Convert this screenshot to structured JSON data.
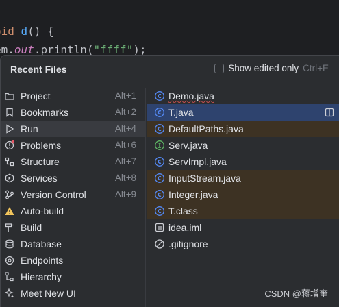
{
  "editor": {
    "line1": {
      "keyword": "oid",
      "method": "d",
      "rest": "() {"
    },
    "line2": {
      "prefix": "em.",
      "field": "out",
      "call": ".println(",
      "string": "\"ffff\"",
      "suffix": ");"
    }
  },
  "popup": {
    "title": "Recent Files",
    "show_edited_label": "Show edited only",
    "show_edited_shortcut": "Ctrl+E",
    "show_edited_checked": false
  },
  "tool_windows": [
    {
      "label": "Project",
      "shortcut": "Alt+1",
      "icon": "folder-icon"
    },
    {
      "label": "Bookmarks",
      "shortcut": "Alt+2",
      "icon": "bookmark-icon"
    },
    {
      "label": "Run",
      "shortcut": "Alt+4",
      "icon": "run-icon",
      "selected": true
    },
    {
      "label": "Problems",
      "shortcut": "Alt+6",
      "icon": "problems-icon"
    },
    {
      "label": "Structure",
      "shortcut": "Alt+7",
      "icon": "structure-icon"
    },
    {
      "label": "Services",
      "shortcut": "Alt+8",
      "icon": "services-icon"
    },
    {
      "label": "Version Control",
      "shortcut": "Alt+9",
      "icon": "vcs-icon"
    },
    {
      "label": "Auto-build",
      "shortcut": "",
      "icon": "warning-icon"
    },
    {
      "label": "Build",
      "shortcut": "",
      "icon": "hammer-icon"
    },
    {
      "label": "Database",
      "shortcut": "",
      "icon": "database-icon"
    },
    {
      "label": "Endpoints",
      "shortcut": "",
      "icon": "endpoints-icon"
    },
    {
      "label": "Hierarchy",
      "shortcut": "",
      "icon": "hierarchy-icon"
    },
    {
      "label": "Meet New UI",
      "shortcut": "",
      "icon": "sparkle-icon"
    }
  ],
  "recent_files": [
    {
      "label": "Demo.java",
      "icon": "class-icon",
      "tinted": false,
      "underline": true
    },
    {
      "label": "T.java",
      "icon": "class-icon",
      "selected": true
    },
    {
      "label": "DefaultPaths.java",
      "icon": "class-icon",
      "tinted": true
    },
    {
      "label": "Serv.java",
      "icon": "interface-icon",
      "tinted": false
    },
    {
      "label": "ServImpl.java",
      "icon": "class-icon",
      "tinted": false
    },
    {
      "label": "InputStream.java",
      "icon": "class-icon",
      "tinted": true
    },
    {
      "label": "Integer.java",
      "icon": "class-icon",
      "tinted": true
    },
    {
      "label": "T.class",
      "icon": "class-icon",
      "tinted": true
    },
    {
      "label": "idea.iml",
      "icon": "module-file-icon",
      "tinted": false
    },
    {
      "label": ".gitignore",
      "icon": "ignore-icon",
      "tinted": false
    }
  ],
  "watermark": "CSDN @蒋增奎",
  "colors": {
    "accent": "#3574f0",
    "selection": "#2e436e",
    "tinted_row": "#3d3223",
    "class_icon": "#548af7",
    "interface_icon": "#5fb865",
    "warning": "#f2c55c"
  }
}
